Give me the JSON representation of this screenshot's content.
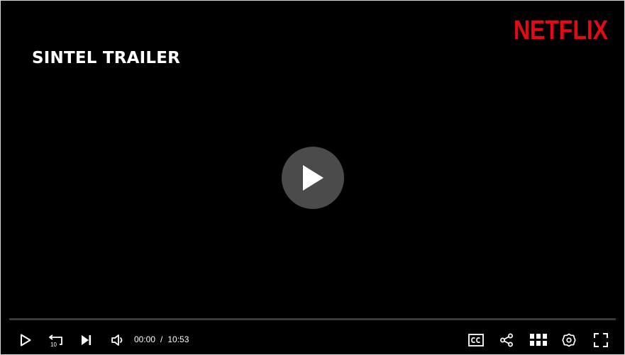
{
  "brand": {
    "logo_text": "NETFLIX",
    "color": "#E50914"
  },
  "video": {
    "title": "SINTEL TRAILER"
  },
  "playback": {
    "current_time": "00:00",
    "separator": "/",
    "duration": "10:53",
    "progress": 0
  },
  "controls": {
    "left": [
      "play-icon",
      "rewind-10-icon",
      "skip-next-icon",
      "volume-icon"
    ],
    "right": [
      "closed-captions-icon",
      "share-icon",
      "grid-icon",
      "settings-icon",
      "fullscreen-icon"
    ],
    "rewind_seconds": "10"
  },
  "big_play_button": {
    "icon": "play-icon"
  }
}
